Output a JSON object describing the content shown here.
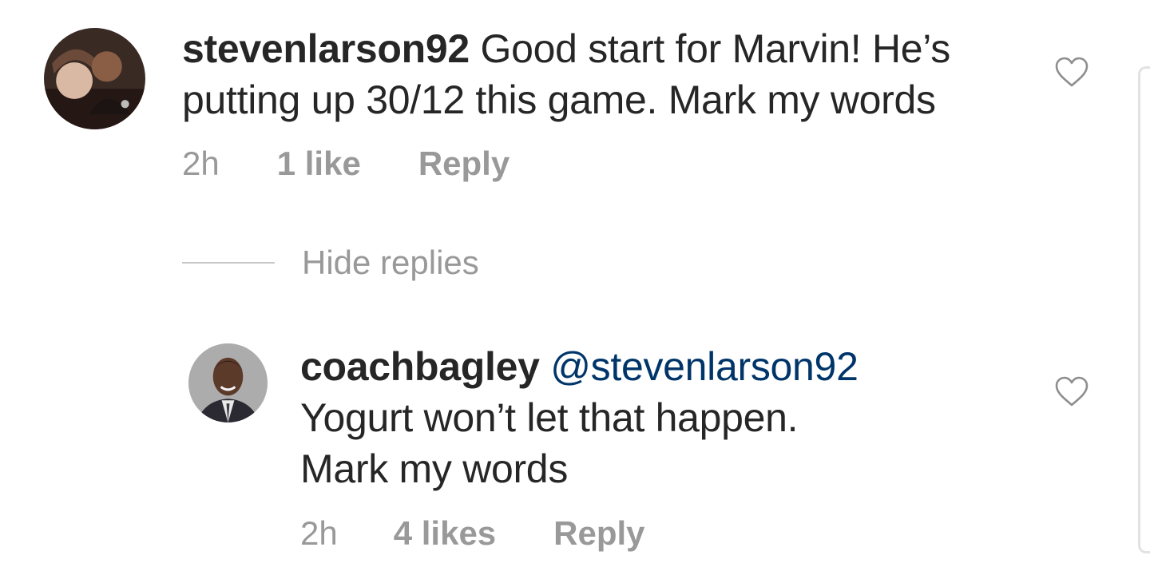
{
  "comment": {
    "username": "stevenlarson92",
    "text": " Good start for Marvin! He’s putting up 30/12 this game. Mark my words",
    "time": "2h",
    "likes": "1 like",
    "reply_label": "Reply",
    "avatar_icon": "user-avatar-couple",
    "like_icon": "heart-outline-icon"
  },
  "hide_replies_label": "Hide replies",
  "reply": {
    "username": "coachbagley",
    "mention": "@stevenlarson92",
    "text_line1": "Yogurt won’t let that happen.",
    "text_line2": "Mark my words",
    "time": "2h",
    "likes": "4 likes",
    "reply_label": "Reply",
    "avatar_icon": "user-avatar-man-suit",
    "like_icon": "heart-outline-icon"
  },
  "colors": {
    "text": "#262626",
    "muted": "#999999",
    "mention": "#003569",
    "divider": "#c7c7c7"
  }
}
